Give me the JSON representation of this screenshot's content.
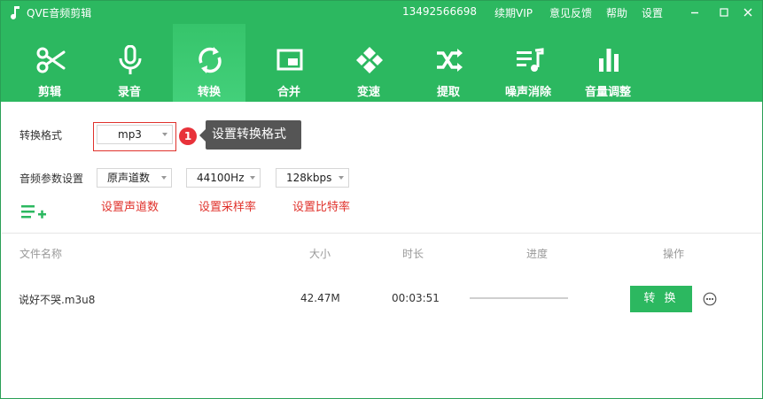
{
  "window": {
    "title": "QVE音频剪辑",
    "phone": "13492566698",
    "links": [
      "续期VIP",
      "意见反馈",
      "帮助",
      "设置"
    ],
    "controls": [
      "minimize-icon",
      "maximize-icon",
      "close-icon"
    ]
  },
  "toolbar": {
    "active": "转换",
    "items": [
      {
        "label": "剪辑",
        "icon": "scissors-icon"
      },
      {
        "label": "录音",
        "icon": "microphone-icon"
      },
      {
        "label": "转换",
        "icon": "convert-icon"
      },
      {
        "label": "合并",
        "icon": "merge-icon"
      },
      {
        "label": "变速",
        "icon": "speed-icon"
      },
      {
        "label": "提取",
        "icon": "shuffle-icon"
      },
      {
        "label": "噪声消除",
        "icon": "denoise-icon"
      },
      {
        "label": "音量调整",
        "icon": "volume-bars-icon"
      }
    ]
  },
  "settings": {
    "format_label": "转换格式",
    "format_value": "mp3",
    "step_number": "1",
    "tooltip": "设置转换格式",
    "params_label": "音频参数设置",
    "channels_value": "原声道数",
    "sample_rate_value": "44100Hz",
    "bitrate_value": "128kbps",
    "channels_note": "设置声道数",
    "sample_rate_note": "设置采样率",
    "bitrate_note": "设置比特率"
  },
  "table": {
    "headers": {
      "name": "文件名称",
      "size": "大小",
      "duration": "时长",
      "progress": "进度",
      "action": "操作"
    },
    "rows": [
      {
        "name": "说好不哭.m3u8",
        "size": "42.47M",
        "duration": "00:03:51",
        "progress": 0,
        "action_label": "转 换"
      }
    ]
  },
  "colors": {
    "brand_green": "#2cb860",
    "accent_red": "#e0322c",
    "tooltip_bg": "#555555"
  }
}
